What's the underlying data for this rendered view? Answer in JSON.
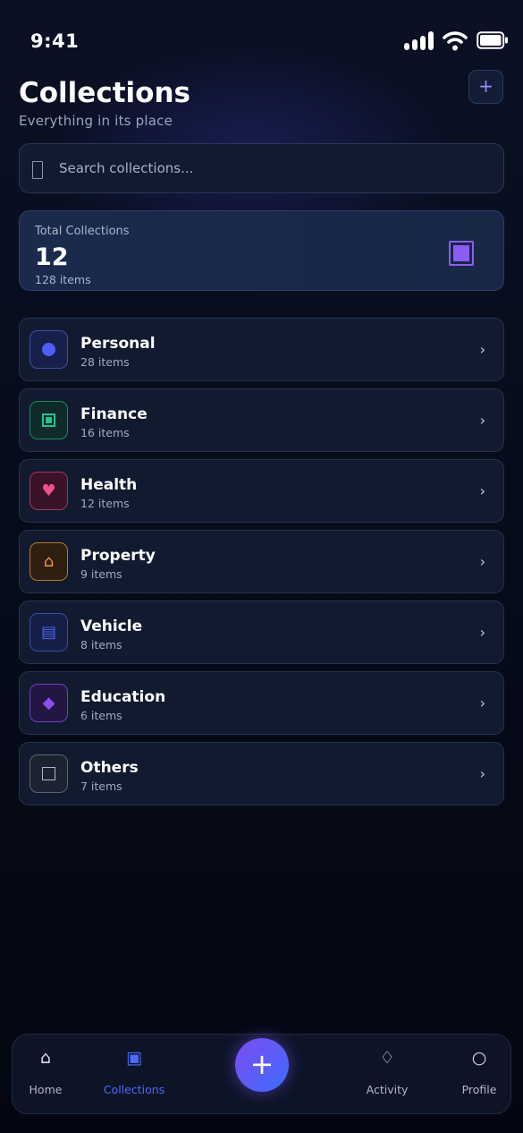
{
  "status_bar": {
    "time": "9:41"
  },
  "header": {
    "title": "Collections",
    "subtitle": "Everything in its place",
    "add_icon": "+"
  },
  "search": {
    "placeholder": "Search collections..."
  },
  "stats": {
    "label": "Total Collections",
    "value": "12",
    "sub": "128 items",
    "accent": "#8b5cf6"
  },
  "collections": [
    {
      "title": "Personal",
      "sub": "28 items",
      "icon": "circle-icon",
      "color": "#4f5ff5"
    },
    {
      "title": "Finance",
      "sub": "16 items",
      "icon": "square-box-icon",
      "color": "#22c58a"
    },
    {
      "title": "Health",
      "sub": "12 items",
      "icon": "heart-icon",
      "glyph": "♥",
      "color": "#f0508a"
    },
    {
      "title": "Property",
      "sub": "9 items",
      "icon": "house-icon",
      "glyph": "⌂",
      "color": "#f29b38"
    },
    {
      "title": "Vehicle",
      "sub": "8 items",
      "icon": "document-icon",
      "glyph": "▤",
      "color": "#4f63f0"
    },
    {
      "title": "Education",
      "sub": "6 items",
      "icon": "diamond-icon",
      "glyph": "◆",
      "color": "#8b4ff0"
    },
    {
      "title": "Others",
      "sub": "7 items",
      "icon": "square-icon",
      "color": "#9aa3b2"
    }
  ],
  "chevron": "›",
  "bottom_nav": {
    "home": {
      "label": "Home",
      "icon": "⌂"
    },
    "collections": {
      "label": "Collections",
      "icon": "▣"
    },
    "fab": {
      "icon": "+"
    },
    "activity": {
      "label": "Activity",
      "icon": "♢"
    },
    "profile": {
      "label": "Profile",
      "icon": "○"
    }
  }
}
